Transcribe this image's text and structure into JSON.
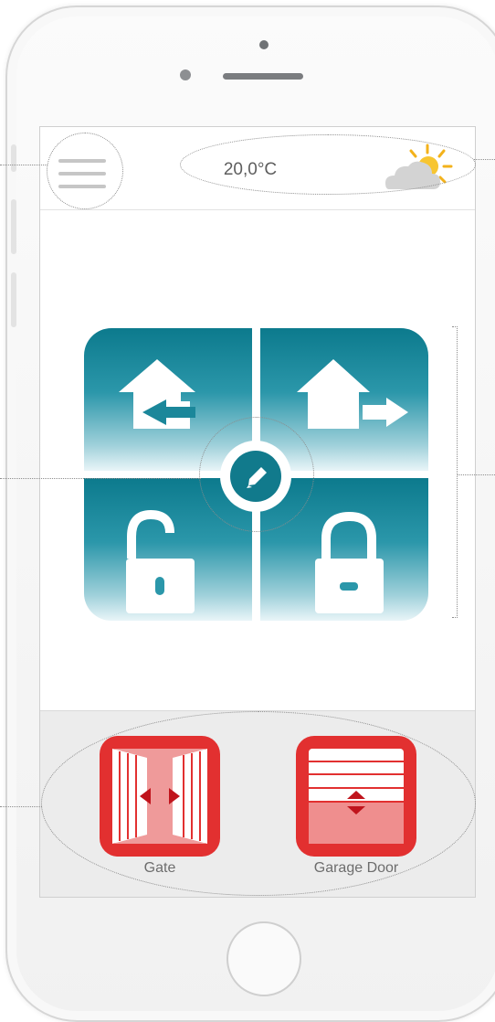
{
  "header": {
    "temperature": "20,0°C",
    "weather_icon": "partly-sunny-icon",
    "menu_icon": "hamburger-menu-icon"
  },
  "controls": {
    "tiles": [
      {
        "icon": "house-arrive-icon"
      },
      {
        "icon": "house-leave-icon"
      },
      {
        "icon": "unlock-icon"
      },
      {
        "icon": "lock-icon"
      }
    ],
    "center_icon": "pencil-edit-icon"
  },
  "devices": [
    {
      "label": "Gate",
      "icon": "gate-icon"
    },
    {
      "label": "Garage Door",
      "icon": "garage-door-icon"
    }
  ],
  "colors": {
    "teal": "#117a8c",
    "device_red": "#e23030",
    "temperature_text": "#5e5e5e"
  }
}
